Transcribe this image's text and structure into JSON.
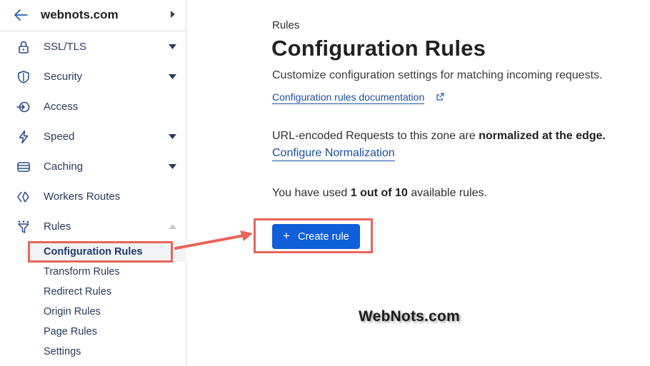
{
  "site": {
    "name": "webnots.com"
  },
  "sidebar": {
    "items": [
      {
        "label": "SSL/TLS",
        "icon": "lock-icon",
        "caret": "down"
      },
      {
        "label": "Security",
        "icon": "shield-icon",
        "caret": "down"
      },
      {
        "label": "Access",
        "icon": "access-icon",
        "caret": "none"
      },
      {
        "label": "Speed",
        "icon": "lightning-icon",
        "caret": "down"
      },
      {
        "label": "Caching",
        "icon": "storage-icon",
        "caret": "down"
      },
      {
        "label": "Workers Routes",
        "icon": "workers-icon",
        "caret": "none"
      },
      {
        "label": "Rules",
        "icon": "funnel-icon",
        "caret": "up"
      }
    ],
    "rules_subitems": [
      {
        "label": "Configuration Rules",
        "active": true
      },
      {
        "label": "Transform Rules"
      },
      {
        "label": "Redirect Rules"
      },
      {
        "label": "Origin Rules"
      },
      {
        "label": "Page Rules"
      },
      {
        "label": "Settings"
      }
    ]
  },
  "main": {
    "breadcrumb": "Rules",
    "title": "Configuration Rules",
    "subtitle": "Customize configuration settings for matching incoming requests.",
    "doc_link": "Configuration rules documentation",
    "normalization": {
      "text_prefix": "URL-encoded Requests to this zone are ",
      "text_bold": "normalized at the edge.",
      "link": "Configure Normalization"
    },
    "usage": {
      "prefix": "You have used ",
      "bold": "1 out of 10",
      "suffix": " available rules."
    },
    "create_button": {
      "plus": "+",
      "label": "Create rule"
    }
  },
  "watermark": "WebNots.com",
  "colors": {
    "accent": "#0e5fd8",
    "link": "#1d4fa0",
    "annotation": "#e8655a"
  }
}
